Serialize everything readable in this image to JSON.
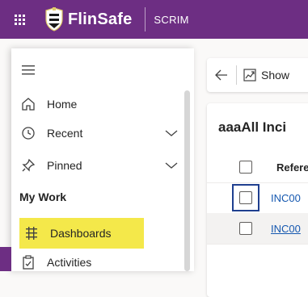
{
  "topbar": {
    "brand": "FlinSafe",
    "app_name": "SCRIM",
    "colors": {
      "bar": "#6d2e83"
    }
  },
  "sidebar": {
    "menu_icon": "hamburger-icon",
    "items": [
      {
        "label": "Home",
        "icon": "home-icon"
      },
      {
        "label": "Recent",
        "icon": "clock-icon",
        "expandable": true
      },
      {
        "label": "Pinned",
        "icon": "pin-icon",
        "expandable": true
      }
    ],
    "section_heading": "My Work",
    "work_items": [
      {
        "label": "Dashboards",
        "icon": "dashboard-icon",
        "selected": true
      },
      {
        "label": "Activities",
        "icon": "clipboard-icon"
      }
    ],
    "colors": {
      "selected": "#f4e84a"
    }
  },
  "main": {
    "commandbar": {
      "show_label": "Show"
    },
    "view": {
      "title": "aaaAll Inci",
      "column_header": "Refere",
      "rows": [
        {
          "reference": "INC00"
        },
        {
          "reference": "INC00"
        }
      ]
    }
  }
}
